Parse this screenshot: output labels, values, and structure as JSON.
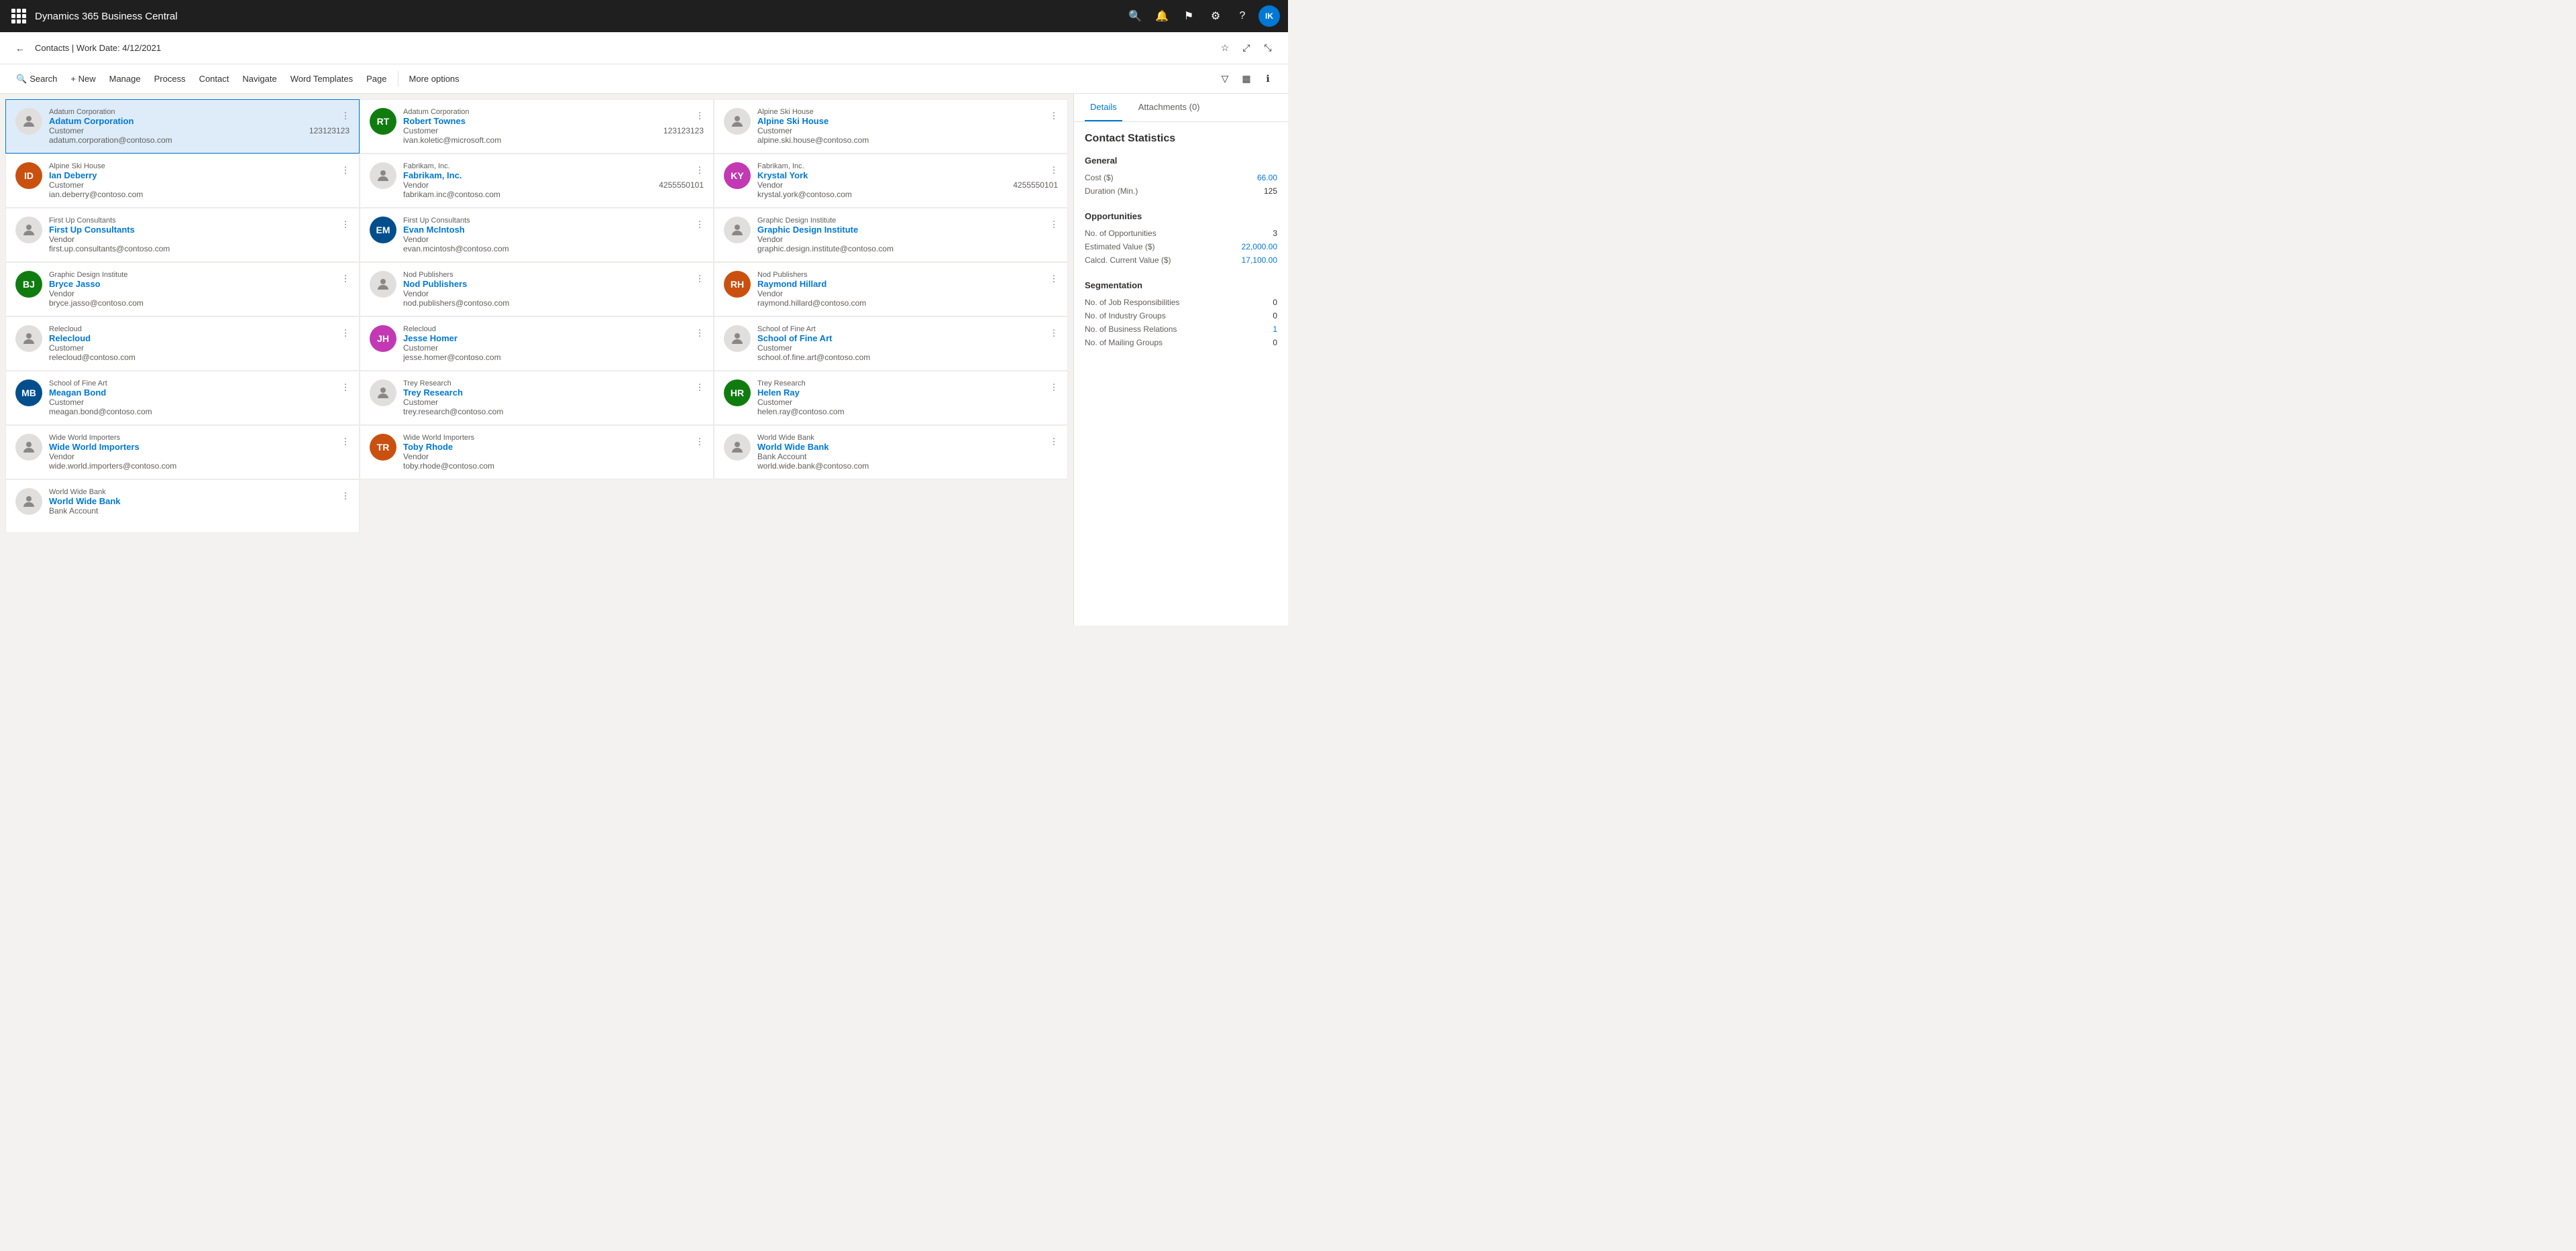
{
  "app": {
    "title": "Dynamics 365 Business Central"
  },
  "header": {
    "breadcrumb": "Contacts | Work Date: 4/12/2021",
    "back_label": "←"
  },
  "toolbar": {
    "search_label": "Search",
    "new_label": "+ New",
    "manage_label": "Manage",
    "process_label": "Process",
    "contact_label": "Contact",
    "navigate_label": "Navigate",
    "word_templates_label": "Word Templates",
    "page_label": "Page",
    "more_options_label": "More options"
  },
  "contacts": [
    {
      "company": "Adatum Corporation",
      "name": "Adatum Corporation",
      "type": "Customer",
      "phone": "123123123",
      "email": "adatum.corporation@contoso.com",
      "selected": true,
      "has_avatar": false,
      "avatar_text": ""
    },
    {
      "company": "Adatum Corporation",
      "name": "Robert Townes",
      "type": "Customer",
      "phone": "123123123",
      "email": "ivan.koletic@microsoft.com",
      "selected": false,
      "has_avatar": true,
      "avatar_text": "RT",
      "avatar_color": "person"
    },
    {
      "company": "Alpine Ski House",
      "name": "Alpine Ski House",
      "type": "Customer",
      "phone": "",
      "email": "alpine.ski.house@contoso.com",
      "selected": false,
      "has_avatar": false,
      "avatar_text": ""
    },
    {
      "company": "Alpine Ski House",
      "name": "Ian Deberry",
      "type": "Customer",
      "phone": "",
      "email": "ian.deberry@contoso.com",
      "selected": false,
      "has_avatar": true,
      "avatar_text": "ID"
    },
    {
      "company": "Fabrikam, Inc.",
      "name": "Fabrikam, Inc.",
      "type": "Vendor",
      "phone": "4255550101",
      "email": "fabrikam.inc@contoso.com",
      "selected": false,
      "has_avatar": false,
      "avatar_text": ""
    },
    {
      "company": "Fabrikam, Inc.",
      "name": "Krystal York",
      "type": "Vendor",
      "phone": "4255550101",
      "email": "krystal.york@contoso.com",
      "selected": false,
      "has_avatar": true,
      "avatar_text": "KY"
    },
    {
      "company": "First Up Consultants",
      "name": "First Up Consultants",
      "type": "Vendor",
      "phone": "",
      "email": "first.up.consultants@contoso.com",
      "selected": false,
      "has_avatar": false,
      "avatar_text": ""
    },
    {
      "company": "First Up Consultants",
      "name": "Evan McIntosh",
      "type": "Vendor",
      "phone": "",
      "email": "evan.mcintosh@contoso.com",
      "selected": false,
      "has_avatar": true,
      "avatar_text": "EM"
    },
    {
      "company": "Graphic Design Institute",
      "name": "Graphic Design Institute",
      "type": "Vendor",
      "phone": "",
      "email": "graphic.design.institute@contoso.com",
      "selected": false,
      "has_avatar": false,
      "avatar_text": ""
    },
    {
      "company": "Graphic Design Institute",
      "name": "Bryce Jasso",
      "type": "Vendor",
      "phone": "",
      "email": "bryce.jasso@contoso.com",
      "selected": false,
      "has_avatar": true,
      "avatar_text": "BJ"
    },
    {
      "company": "Nod Publishers",
      "name": "Nod Publishers",
      "type": "Vendor",
      "phone": "",
      "email": "nod.publishers@contoso.com",
      "selected": false,
      "has_avatar": false,
      "avatar_text": ""
    },
    {
      "company": "Nod Publishers",
      "name": "Raymond Hillard",
      "type": "Vendor",
      "phone": "",
      "email": "raymond.hillard@contoso.com",
      "selected": false,
      "has_avatar": true,
      "avatar_text": "RH"
    },
    {
      "company": "Relecloud",
      "name": "Relecloud",
      "type": "Customer",
      "phone": "",
      "email": "relecloud@contoso.com",
      "selected": false,
      "has_avatar": false,
      "avatar_text": ""
    },
    {
      "company": "Relecloud",
      "name": "Jesse Homer",
      "type": "Customer",
      "phone": "",
      "email": "jesse.homer@contoso.com",
      "selected": false,
      "has_avatar": true,
      "avatar_text": "JH"
    },
    {
      "company": "School of Fine Art",
      "name": "School of Fine Art",
      "type": "Customer",
      "phone": "",
      "email": "school.of.fine.art@contoso.com",
      "selected": false,
      "has_avatar": false,
      "avatar_text": ""
    },
    {
      "company": "School of Fine Art",
      "name": "Meagan Bond",
      "type": "Customer",
      "phone": "",
      "email": "meagan.bond@contoso.com",
      "selected": false,
      "has_avatar": true,
      "avatar_text": "MB"
    },
    {
      "company": "Trey Research",
      "name": "Trey Research",
      "type": "Customer",
      "phone": "",
      "email": "trey.research@contoso.com",
      "selected": false,
      "has_avatar": false,
      "avatar_text": ""
    },
    {
      "company": "Trey Research",
      "name": "Helen Ray",
      "type": "Customer",
      "phone": "",
      "email": "helen.ray@contoso.com",
      "selected": false,
      "has_avatar": true,
      "avatar_text": "HR"
    },
    {
      "company": "Wide World Importers",
      "name": "Wide World Importers",
      "type": "Vendor",
      "phone": "",
      "email": "wide.world.importers@contoso.com",
      "selected": false,
      "has_avatar": false,
      "avatar_text": ""
    },
    {
      "company": "Wide World Importers",
      "name": "Toby Rhode",
      "type": "Vendor",
      "phone": "",
      "email": "toby.rhode@contoso.com",
      "selected": false,
      "has_avatar": true,
      "avatar_text": "TR"
    },
    {
      "company": "World Wide Bank",
      "name": "World Wide Bank",
      "type": "Bank Account",
      "phone": "",
      "email": "world.wide.bank@contoso.com",
      "selected": false,
      "has_avatar": false,
      "avatar_text": ""
    },
    {
      "company": "World Wide Bank",
      "name": "World Wide Bank",
      "type": "Bank Account",
      "phone": "",
      "email": "",
      "selected": false,
      "has_avatar": false,
      "avatar_text": "",
      "partial": true
    }
  ],
  "right_panel": {
    "tabs": [
      {
        "label": "Details",
        "icon": "ℹ",
        "active": true
      },
      {
        "label": "Attachments (0)",
        "icon": "📎",
        "active": false
      }
    ],
    "title": "Contact Statistics",
    "sections": [
      {
        "title": "General",
        "rows": [
          {
            "label": "Cost ($)",
            "value": "66.00",
            "blue": true
          },
          {
            "label": "Duration (Min.)",
            "value": "125",
            "blue": false
          }
        ]
      },
      {
        "title": "Opportunities",
        "rows": [
          {
            "label": "No. of Opportunities",
            "value": "3",
            "blue": false
          },
          {
            "label": "Estimated Value ($)",
            "value": "22,000.00",
            "blue": true
          },
          {
            "label": "Calcd. Current Value ($)",
            "value": "17,100.00",
            "blue": true
          }
        ]
      },
      {
        "title": "Segmentation",
        "rows": [
          {
            "label": "No. of Job Responsibilities",
            "value": "0",
            "blue": false
          },
          {
            "label": "No. of Industry Groups",
            "value": "0",
            "blue": false
          },
          {
            "label": "No. of Business Relations",
            "value": "1",
            "blue": true
          },
          {
            "label": "No. of Mailing Groups",
            "value": "0",
            "blue": false
          }
        ]
      }
    ]
  },
  "icons": {
    "waffle": "⊞",
    "search": "🔍",
    "bell": "🔔",
    "flag": "⚑",
    "gear": "⚙",
    "question": "?",
    "back": "←",
    "bookmark": "☆",
    "expand": "⤢",
    "collapse": "⤡",
    "filter": "▽",
    "columns": "▦",
    "info": "ℹ",
    "more": "•••",
    "person": "👤"
  }
}
